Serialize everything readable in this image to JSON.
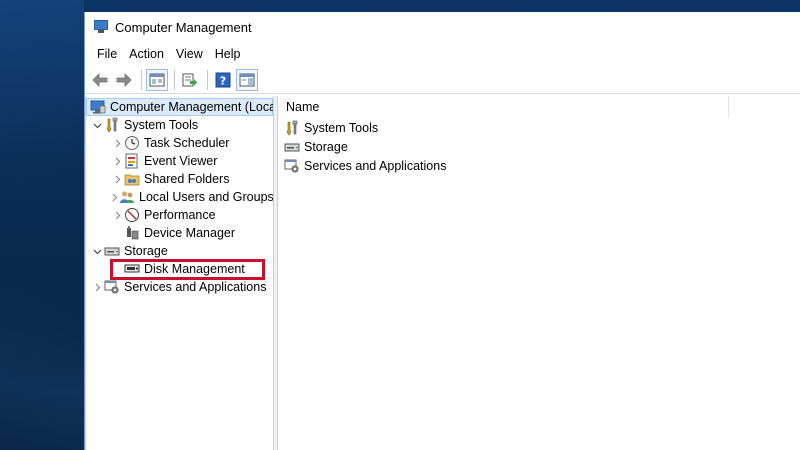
{
  "window": {
    "title": "Computer Management"
  },
  "menu": {
    "file": "File",
    "action": "Action",
    "view": "View",
    "help": "Help"
  },
  "tree": {
    "root": "Computer Management (Local",
    "system_tools": "System Tools",
    "task_scheduler": "Task Scheduler",
    "event_viewer": "Event Viewer",
    "shared_folders": "Shared Folders",
    "local_users": "Local Users and Groups",
    "performance": "Performance",
    "device_manager": "Device Manager",
    "storage": "Storage",
    "disk_management": "Disk Management",
    "services_apps": "Services and Applications"
  },
  "list": {
    "column_name": "Name",
    "items": [
      "System Tools",
      "Storage",
      "Services and Applications"
    ]
  },
  "colors": {
    "highlight": "#c8102e",
    "selection": "#dcebfc",
    "desktop": "#0b2d57"
  }
}
